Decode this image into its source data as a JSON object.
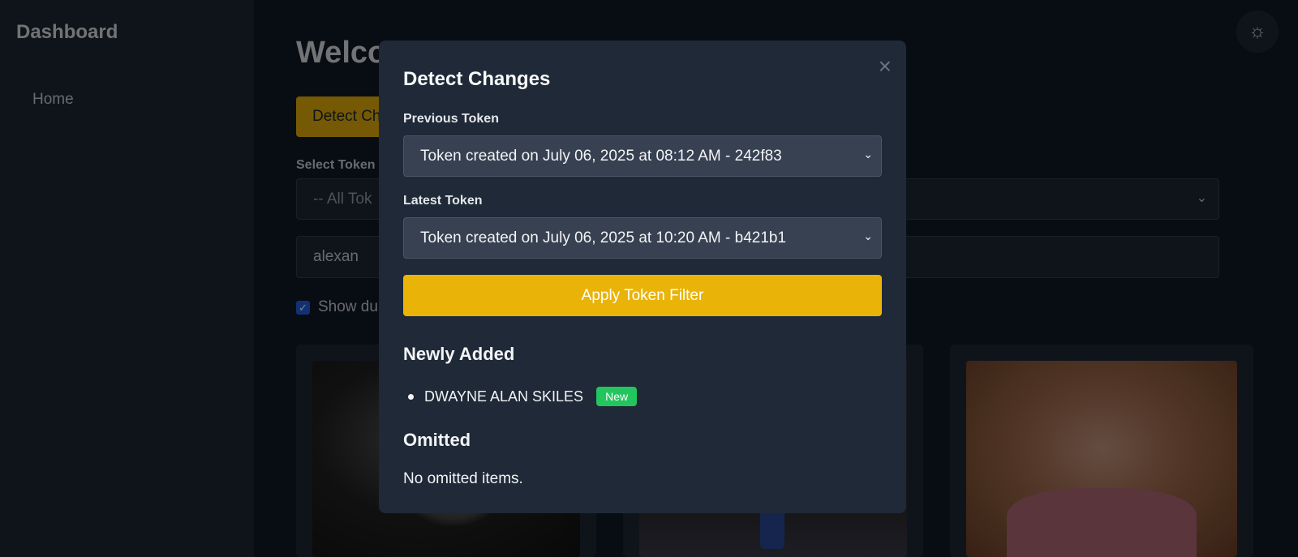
{
  "sidebar": {
    "brand": "Dashboard",
    "items": [
      {
        "label": "Home"
      }
    ]
  },
  "main": {
    "welcome": "Welco",
    "detect_button_label": "Detect Ch",
    "select_token_label": "Select Token",
    "select_token_value": "-- All Tok",
    "search_value": "alexan",
    "show_duplicates_label": "Show du"
  },
  "theme_toggle_icon": "sun-icon",
  "modal": {
    "title": "Detect Changes",
    "close": "×",
    "previous_label": "Previous Token",
    "previous_value": "Token created on July 06, 2025 at 08:12 AM - 242f83",
    "latest_label": "Latest Token",
    "latest_value": "Token created on July 06, 2025 at 10:20 AM - b421b1",
    "apply_label": "Apply Token Filter",
    "newly_added_title": "Newly Added",
    "newly_added_items": [
      {
        "name": "DWAYNE ALAN SKILES",
        "badge": "New"
      }
    ],
    "omitted_title": "Omitted",
    "omitted_text": "No omitted items."
  },
  "colors": {
    "accent": "#eab308",
    "badge_green": "#22c55e",
    "modal_bg": "#1f2937"
  }
}
